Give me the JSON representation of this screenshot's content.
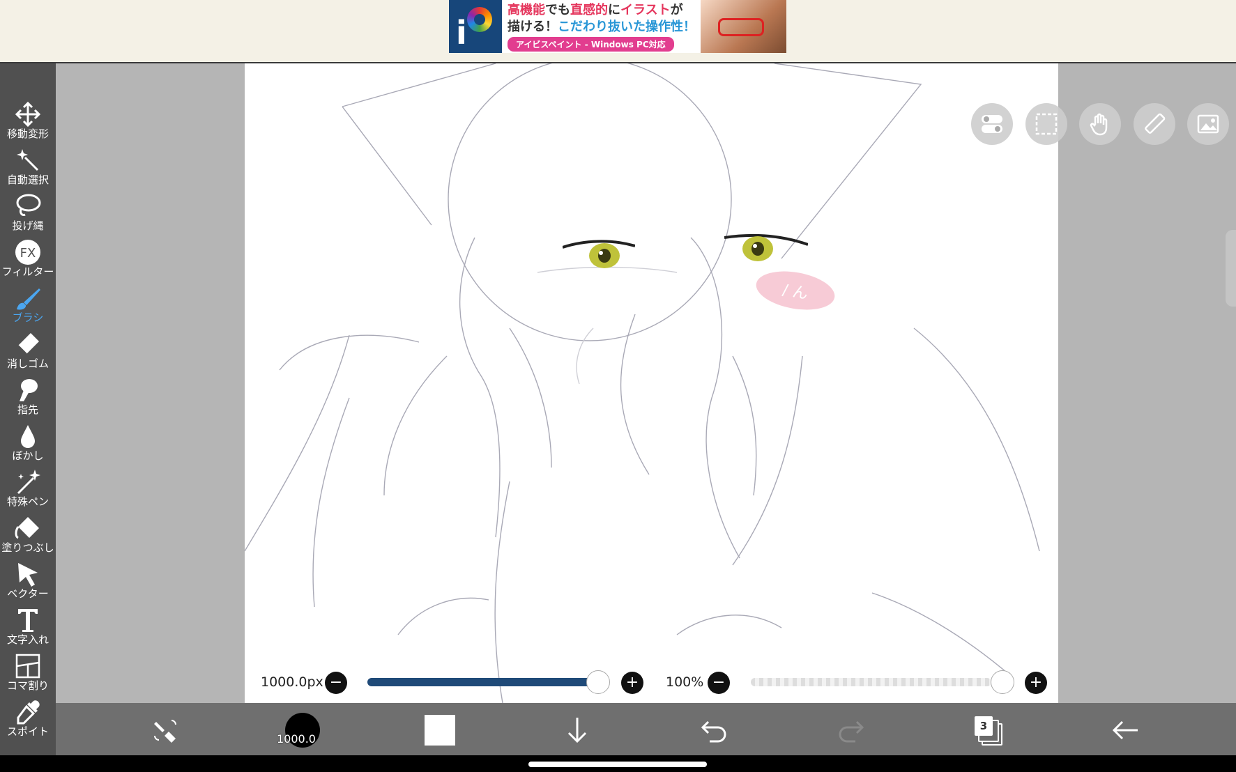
{
  "ad": {
    "logo_letter": "i",
    "line1_prefix": "高機能",
    "line1_mid": "でも",
    "line1_hl": "直感的",
    "line1_mid2": "に",
    "line1_hl2": "イラスト",
    "line1_suffix": "が",
    "line2_prefix": "描ける！",
    "line2_hl": "こだわり抜いた操作性！",
    "pill": "アイビスペイント - Windows PC対応"
  },
  "tools": [
    {
      "label": "移動変形",
      "icon": "move-icon"
    },
    {
      "label": "自動選択",
      "icon": "magic-wand-icon"
    },
    {
      "label": "投げ縄",
      "icon": "lasso-icon"
    },
    {
      "label": "フィルター",
      "icon": "fx-icon"
    },
    {
      "label": "ブラシ",
      "icon": "brush-icon"
    },
    {
      "label": "消しゴム",
      "icon": "eraser-icon"
    },
    {
      "label": "指先",
      "icon": "finger-icon"
    },
    {
      "label": "ぼかし",
      "icon": "blur-drop-icon"
    },
    {
      "label": "特殊ペン",
      "icon": "special-pen-icon"
    },
    {
      "label": "塗りつぶし",
      "icon": "fill-bucket-icon"
    },
    {
      "label": "ベクター",
      "icon": "vector-cursor-icon"
    },
    {
      "label": "文字入れ",
      "icon": "text-icon"
    },
    {
      "label": "コマ割り",
      "icon": "frame-divider-icon"
    },
    {
      "label": "スポイト",
      "icon": "eyedropper-icon"
    }
  ],
  "active_tool": "ブラシ",
  "brush_size": {
    "label": "1000.0px",
    "value_fraction": 1.0
  },
  "opacity": {
    "label": "100%",
    "value_fraction": 1.0
  },
  "bottom": {
    "brush_preview_label": "1000.0",
    "layer_count": "3"
  },
  "canvas_text": {
    "sketch_note": "/ ん"
  },
  "colors": {
    "active_tool": "#4ba6f0",
    "size_track": "#1f4a78",
    "primary_color": "#ffffff",
    "ad_pink": "#e23d8f"
  }
}
